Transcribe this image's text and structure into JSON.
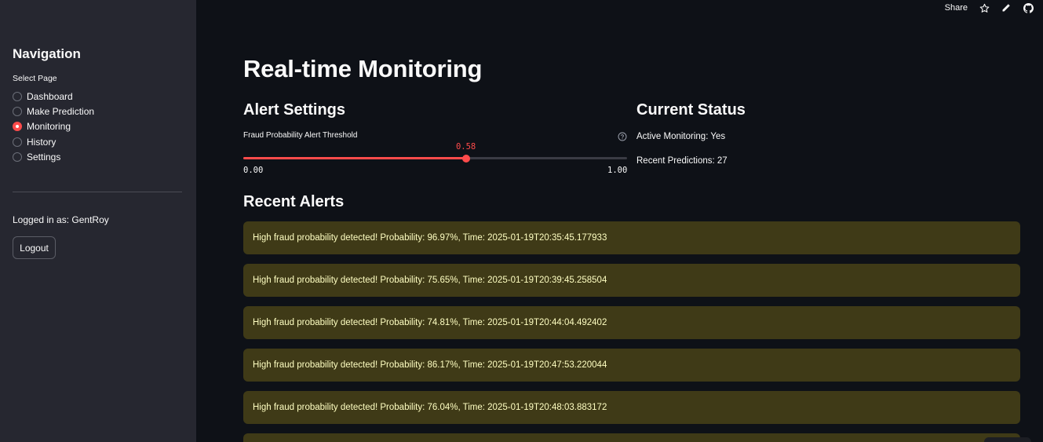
{
  "toolbar": {
    "share_label": "Share",
    "icons": [
      "star-icon",
      "edit-icon",
      "github-icon"
    ]
  },
  "sidebar": {
    "title": "Navigation",
    "select_label": "Select Page",
    "items": [
      {
        "label": "Dashboard",
        "selected": false
      },
      {
        "label": "Make Prediction",
        "selected": false
      },
      {
        "label": "Monitoring",
        "selected": true
      },
      {
        "label": "History",
        "selected": false
      },
      {
        "label": "Settings",
        "selected": false
      }
    ],
    "logged_in_text": "Logged in as: GentRoy",
    "logout_label": "Logout"
  },
  "main": {
    "title": "Real-time Monitoring",
    "alert_settings": {
      "heading": "Alert Settings",
      "slider_label": "Fraud Probability Alert Threshold",
      "value": 0.58,
      "value_text": "0.58",
      "min_text": "0.00",
      "max_text": "1.00",
      "accent_color": "#ff4b4b"
    },
    "current_status": {
      "heading": "Current Status",
      "active_monitoring": "Active Monitoring: Yes",
      "recent_predictions": "Recent Predictions: 27"
    },
    "recent_alerts": {
      "heading": "Recent Alerts",
      "items": [
        "High fraud probability detected! Probability: 96.97%, Time: 2025-01-19T20:35:45.177933",
        "High fraud probability detected! Probability: 75.65%, Time: 2025-01-19T20:39:45.258504",
        "High fraud probability detected! Probability: 74.81%, Time: 2025-01-19T20:44:04.492402",
        "High fraud probability detected! Probability: 86.17%, Time: 2025-01-19T20:47:53.220044",
        "High fraud probability detected! Probability: 76.04%, Time: 2025-01-19T20:48:03.883172"
      ]
    }
  }
}
